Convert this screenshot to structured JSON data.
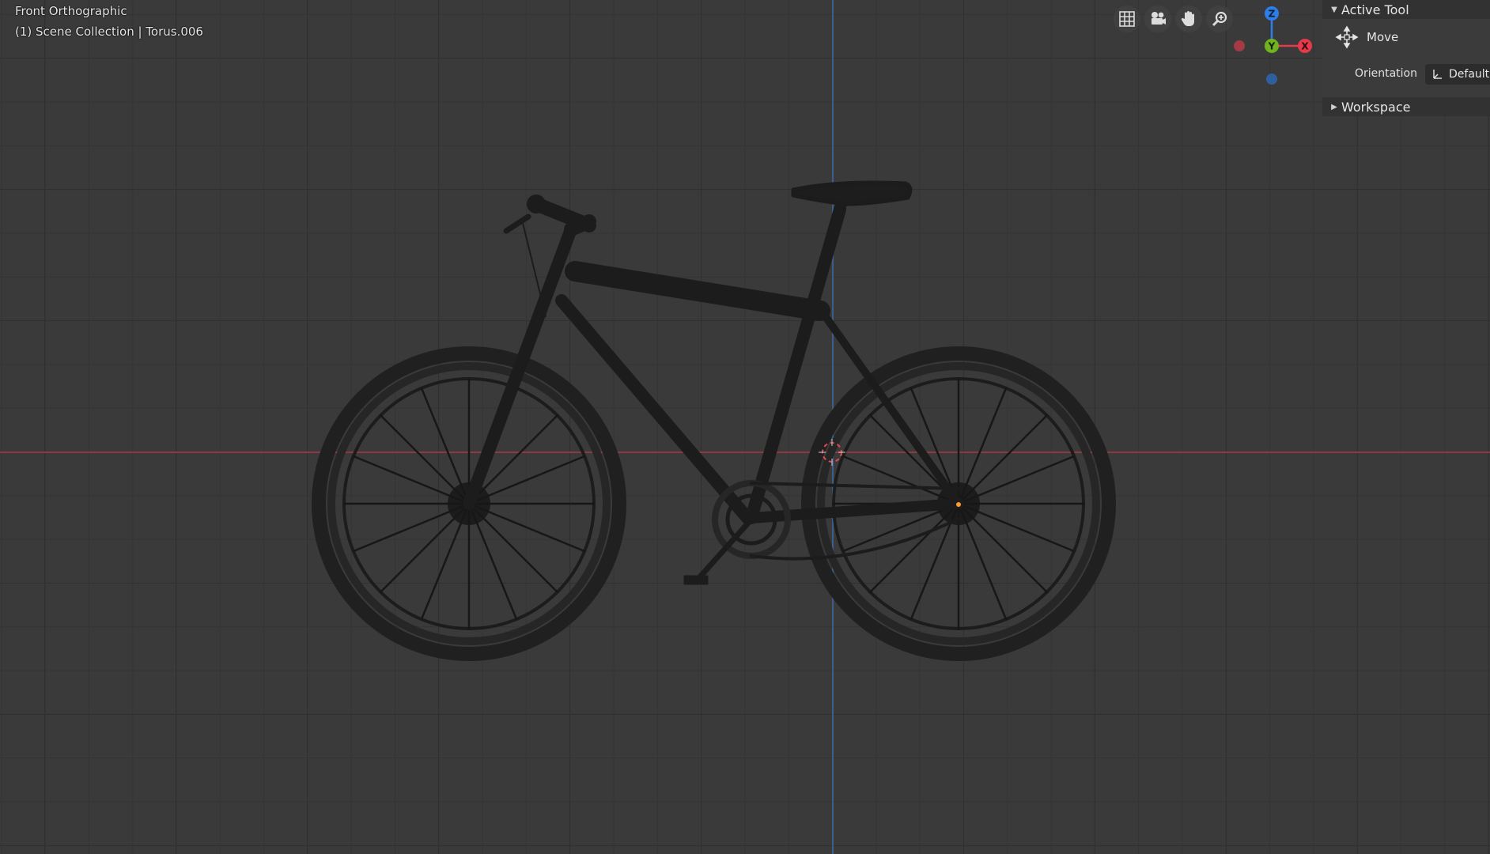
{
  "viewport": {
    "view_name": "Front Orthographic",
    "collection_info": "(1) Scene Collection | Torus.006"
  },
  "navigation": {
    "buttons": [
      {
        "name": "toggle-camera-view",
        "icon": "grid-icon"
      },
      {
        "name": "camera-view",
        "icon": "camera-icon"
      },
      {
        "name": "pan-view",
        "icon": "hand-icon"
      },
      {
        "name": "zoom-view",
        "icon": "magnifier-icon"
      }
    ]
  },
  "gizmo": {
    "z_label": "Z",
    "y_label": "Y",
    "x_label": "X",
    "colors": {
      "z": "#2f7ee8",
      "y": "#71b31e",
      "x": "#e63a4a"
    }
  },
  "panel": {
    "active_tool": {
      "header": "Active Tool",
      "tool_name": "Move",
      "orientation_label": "Orientation",
      "orientation_value": "Default"
    },
    "workspace": {
      "header": "Workspace"
    }
  },
  "colors": {
    "background": "#3a3a3a",
    "x_axis": "#8a3a40",
    "z_axis": "#3a5f8e",
    "bike": "#1b1b1b"
  }
}
